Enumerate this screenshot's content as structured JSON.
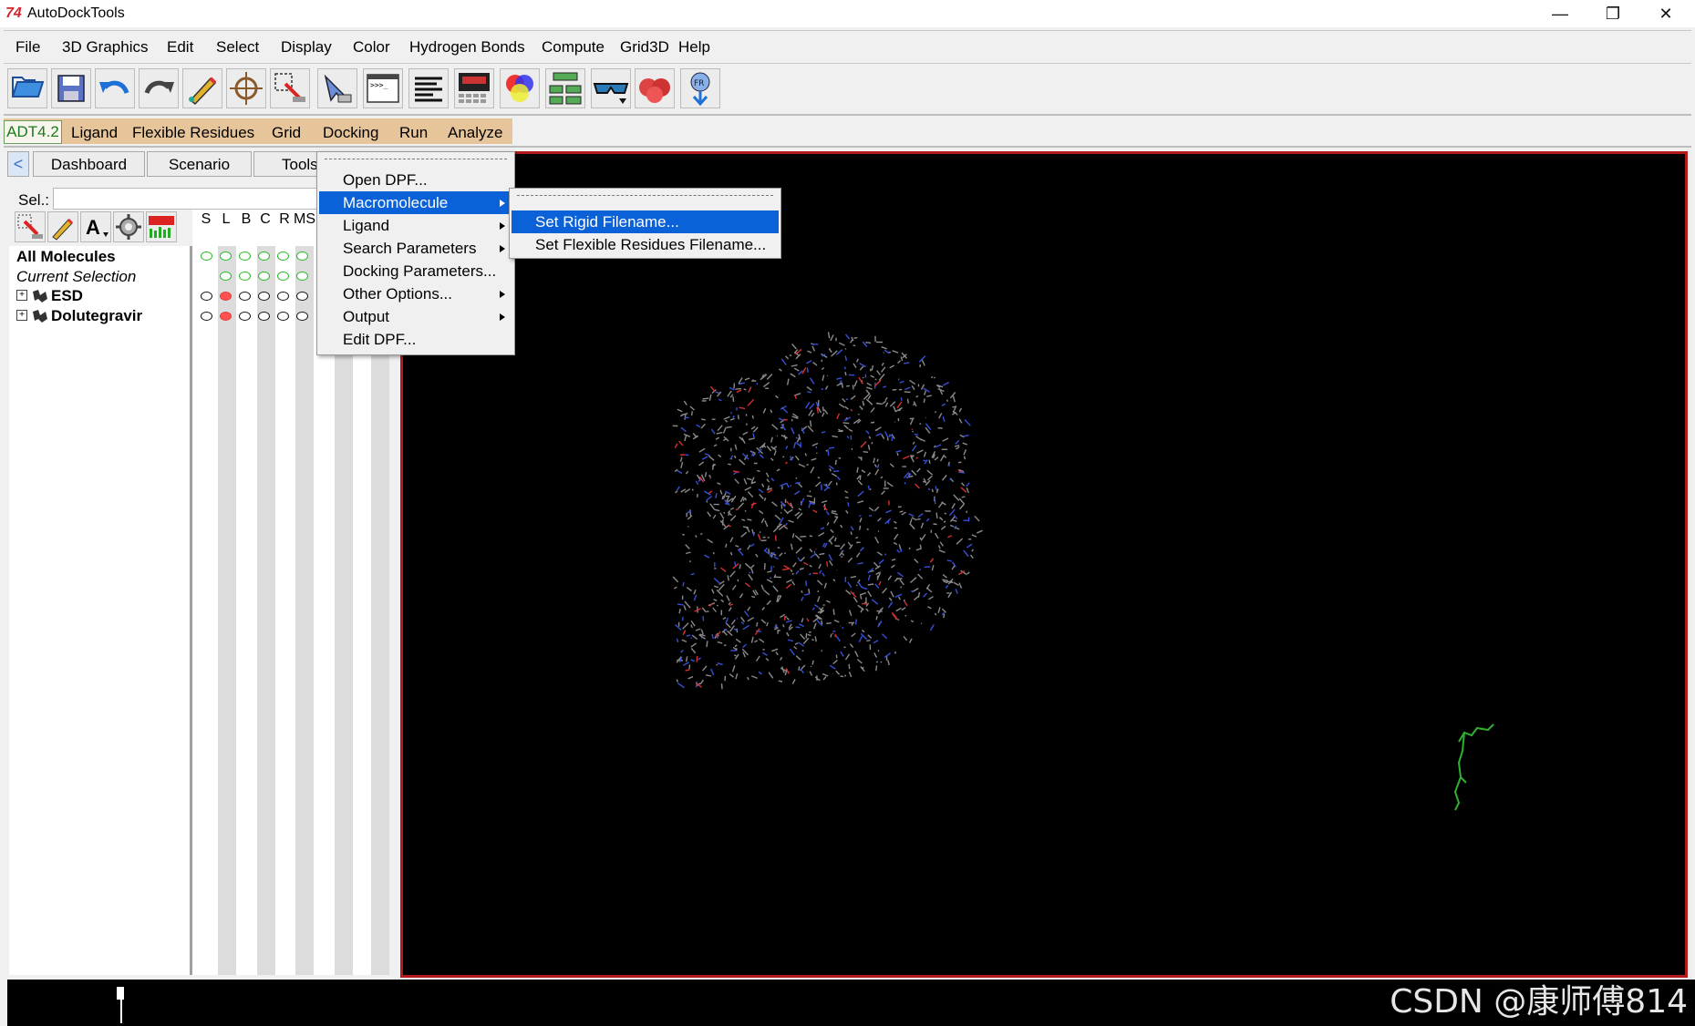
{
  "window": {
    "title": "AutoDockTools",
    "app_icon_glyph": "74",
    "minimize_glyph": "—",
    "restore_glyph": "❐",
    "close_glyph": "✕"
  },
  "menubar": [
    "File",
    "3D Graphics",
    "Edit",
    "Select",
    "Display",
    "Color",
    "Hydrogen Bonds",
    "Compute",
    "Grid3D",
    "Help"
  ],
  "toolbar_icons": [
    "open-file-icon",
    "save-icon",
    "undo-icon",
    "redo-icon",
    "pencil-icon",
    "crosshair-icon",
    "select-pick-icon",
    "pointer-icon",
    "python-shell-icon",
    "text-list-icon",
    "display-icon",
    "color-icon",
    "dashboard-icon",
    "stereo-glasses-icon",
    "surface-icon",
    "bond-icon"
  ],
  "adt": {
    "version": "ADT4.2",
    "menus": [
      "Ligand",
      "Flexible Residues",
      "Grid",
      "Docking",
      "Run",
      "Analyze"
    ]
  },
  "left_tabs": {
    "back_glyph": "<",
    "tabs": [
      "Dashboard",
      "Scenario",
      "Tools"
    ]
  },
  "selection": {
    "label": "Sel.:",
    "value": ""
  },
  "columns": [
    "S",
    "L",
    "B",
    "C",
    "R",
    "MS"
  ],
  "tree": {
    "all": "All Molecules",
    "current": "Current Selection",
    "molecules": [
      "ESD",
      "Dolutegravir"
    ],
    "expand_glyph": "+"
  },
  "docking_menu": {
    "items": [
      {
        "label": "Open DPF...",
        "submenu": false
      },
      {
        "label": "Macromolecule",
        "submenu": true,
        "highlighted": true
      },
      {
        "label": "Ligand",
        "submenu": true
      },
      {
        "label": "Search Parameters",
        "submenu": true
      },
      {
        "label": "Docking Parameters...",
        "submenu": false
      },
      {
        "label": "Other Options...",
        "submenu": true
      },
      {
        "label": "Output",
        "submenu": true
      },
      {
        "label": "Edit DPF...",
        "submenu": false
      }
    ]
  },
  "macromolecule_submenu": {
    "items": [
      {
        "label": "Set Rigid Filename...",
        "highlighted": true
      },
      {
        "label": "Set Flexible Residues Filename..."
      }
    ]
  },
  "watermark": "CSDN @康师傅814",
  "colors": {
    "highlight": "#0a61d8",
    "adt_bar": "#e7c59b",
    "viewer_border": "#b31b1b"
  }
}
